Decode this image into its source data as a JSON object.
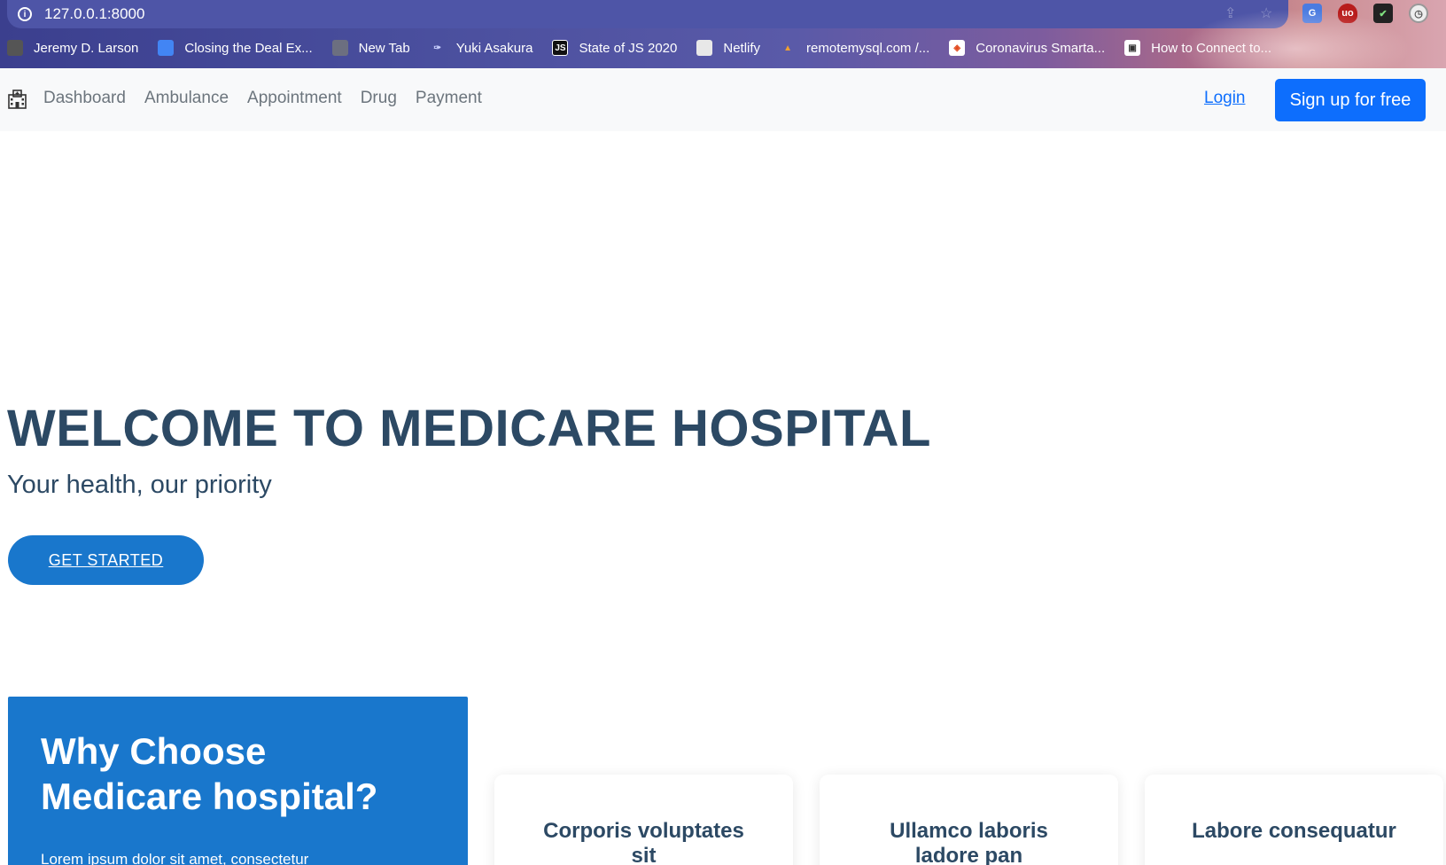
{
  "browser": {
    "url": "127.0.0.1:8000",
    "bookmarks": [
      {
        "label": "Jeremy D. Larson",
        "icon": "cube-icon"
      },
      {
        "label": "Closing the Deal Ex...",
        "icon": "doc-icon"
      },
      {
        "label": "New Tab",
        "icon": "globe-icon"
      },
      {
        "label": "Yuki Asakura",
        "icon": "yuki-icon"
      },
      {
        "label": "State of JS 2020",
        "icon": "js-icon"
      },
      {
        "label": "Netlify",
        "icon": "netlify-icon"
      },
      {
        "label": "remotemysql.com /...",
        "icon": "phpmyadmin-icon"
      },
      {
        "label": "Coronavirus Smarta...",
        "icon": "corona-icon"
      },
      {
        "label": "How to Connect to...",
        "icon": "disk-icon"
      }
    ],
    "extensions": [
      "google-translate-icon",
      "ublock-icon",
      "checkmark-extension-icon",
      "timer-extension-icon"
    ]
  },
  "navbar": {
    "brand_icon": "hospital-icon",
    "links": [
      "Dashboard",
      "Ambulance",
      "Appointment",
      "Drug",
      "Payment"
    ],
    "login": "Login",
    "signup": "Sign up for free"
  },
  "hero": {
    "title": "WELCOME TO MEDICARE HOSPITAL",
    "subtitle": "Your health, our priority",
    "cta": "GET STARTED"
  },
  "why": {
    "title_line1": "Why Choose",
    "title_line2": "Medicare hospital?",
    "text": "Lorem ipsum dolor sit amet, consectetur"
  },
  "cards": [
    {
      "title_line1": "Corporis voluptates",
      "title_line2": "sit"
    },
    {
      "title_line1": "Ullamco laboris",
      "title_line2": "ladore pan"
    },
    {
      "title_line1": "Labore consequatur",
      "title_line2": ""
    }
  ],
  "colors": {
    "primary": "#1977cc",
    "heading": "#2c4964",
    "bootstrap_blue": "#0d6efd",
    "navbar_bg": "#f8f9fa"
  }
}
